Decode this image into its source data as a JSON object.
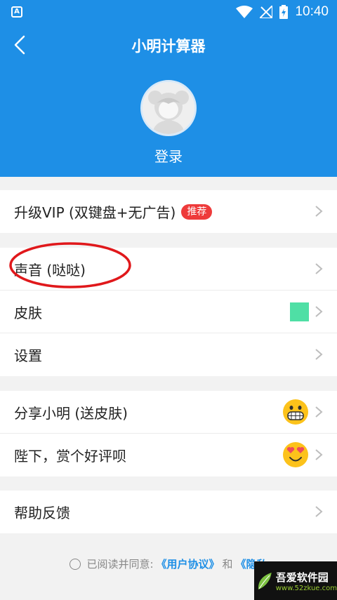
{
  "status_bar": {
    "time": "10:40",
    "app_icon_letter": "A"
  },
  "header": {
    "title": "小明计算器",
    "login_label": "登录"
  },
  "groups": {
    "vip": {
      "label": "升级VIP (双键盘+无广告)",
      "badge": "推荐"
    },
    "sound": {
      "label": "声音 (哒哒)"
    },
    "skin": {
      "label": "皮肤",
      "swatch_color": "#4fdfa5"
    },
    "settings": {
      "label": "设置"
    },
    "share": {
      "label": "分享小明 (送皮肤)",
      "emoji": "grinning-face-icon"
    },
    "review": {
      "label": "陛下，赏个好评呗",
      "emoji": "heart-eyes-icon"
    },
    "help": {
      "label": "帮助反馈"
    }
  },
  "agreement": {
    "prefix": "已阅读并同意:",
    "link1": "《用户协议》",
    "and": "和",
    "link2": "《隐私"
  },
  "watermark": {
    "title": "吾爱软件园",
    "subtitle": "www.52zkue.com"
  },
  "colors": {
    "header_blue": "#1e8fe6",
    "badge_red": "#ee3b3b",
    "annotation_red": "#e0181b"
  }
}
